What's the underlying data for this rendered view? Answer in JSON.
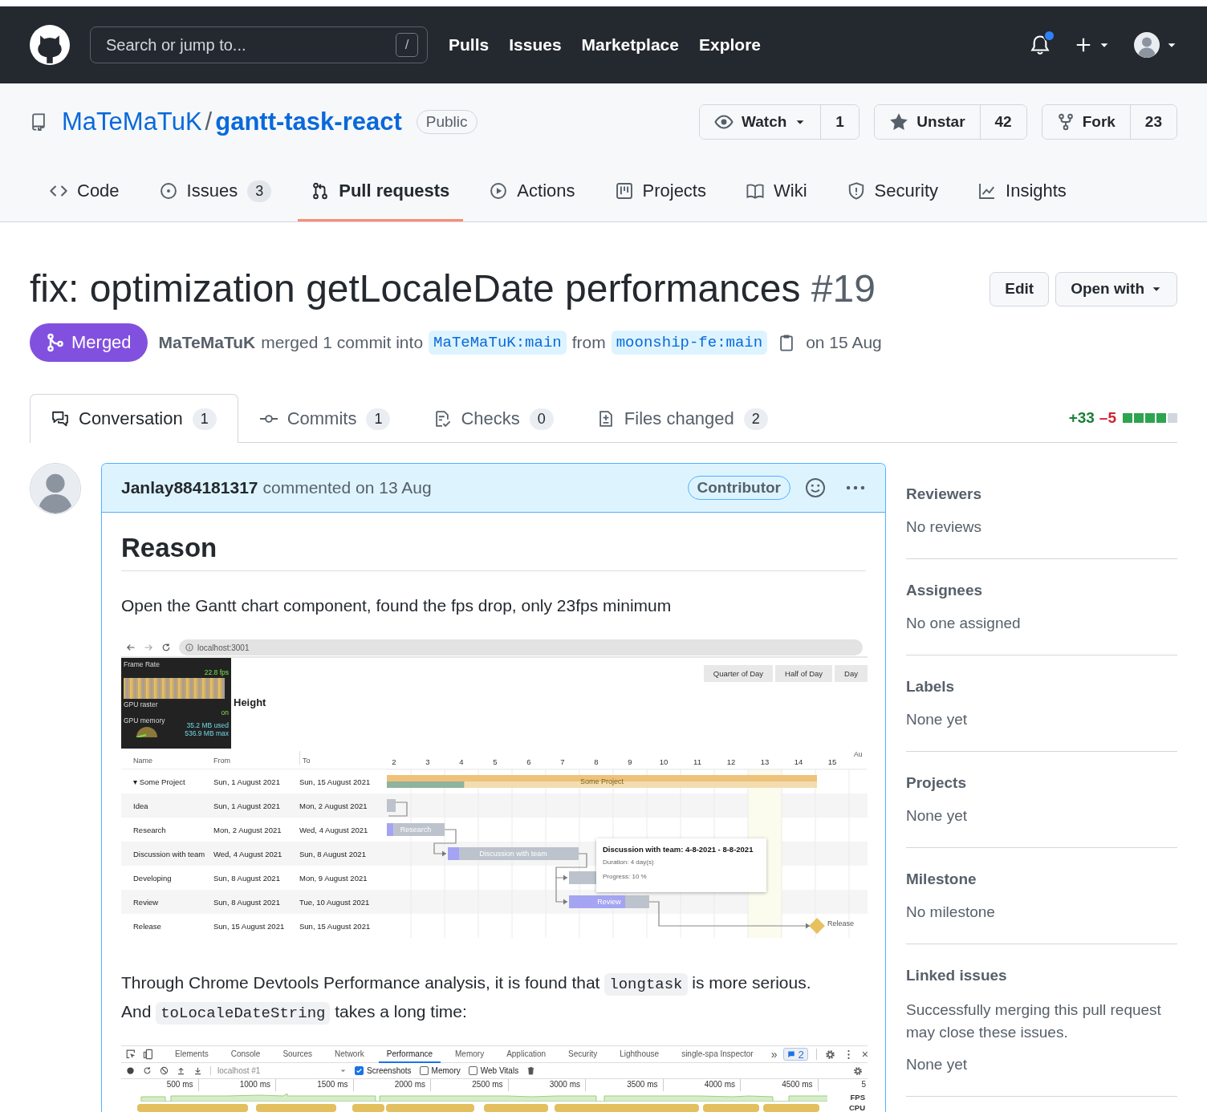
{
  "header": {
    "search_placeholder": "Search or jump to...",
    "search_key": "/",
    "nav": [
      "Pulls",
      "Issues",
      "Marketplace",
      "Explore"
    ],
    "notification_unread": true
  },
  "repo": {
    "owner": "MaTeMaTuK",
    "separator": "/",
    "name": "gantt-task-react",
    "visibility": "Public",
    "actions": [
      {
        "kind": "watch",
        "label": "Watch",
        "count": "1"
      },
      {
        "kind": "star",
        "label": "Unstar",
        "count": "42"
      },
      {
        "kind": "fork",
        "label": "Fork",
        "count": "23"
      }
    ]
  },
  "tabs": [
    {
      "label": "Code",
      "selected": false
    },
    {
      "label": "Issues",
      "count": "3",
      "selected": false
    },
    {
      "label": "Pull requests",
      "selected": true
    },
    {
      "label": "Actions",
      "selected": false
    },
    {
      "label": "Projects",
      "selected": false
    },
    {
      "label": "Wiki",
      "selected": false
    },
    {
      "label": "Security",
      "selected": false
    },
    {
      "label": "Insights",
      "selected": false
    }
  ],
  "pull_request": {
    "title": "fix: optimization getLocaleDate performances",
    "number": "#19",
    "buttons": [
      {
        "kind": "plain",
        "label": "Edit"
      },
      {
        "kind": "menu",
        "label": "Open with"
      }
    ],
    "state": "Merged",
    "author": "MaTeMaTuK",
    "summary": "merged 1 commit into",
    "base_branch": "MaTeMaTuK:main",
    "from": "from",
    "head_branch": "moonship-fe:main",
    "date": "on 15 Aug"
  },
  "pr_tabs": [
    {
      "label": "Conversation",
      "count": "1",
      "selected": true
    },
    {
      "label": "Commits",
      "count": "1",
      "selected": false
    },
    {
      "label": "Checks",
      "count": "0",
      "selected": false
    },
    {
      "label": "Files changed",
      "count": "2",
      "selected": false
    }
  ],
  "diffstat": {
    "additions": "+33",
    "deletions": "–5",
    "blocks": [
      {
        "kind": "added"
      },
      {
        "kind": "added"
      },
      {
        "kind": "added"
      },
      {
        "kind": "added"
      },
      {
        "kind": "neutral"
      }
    ]
  },
  "comment": {
    "author": "Janlay884181317",
    "action": "commented on 13 Aug",
    "role": "Contributor",
    "heading": "Reason",
    "intro": "Open the Gantt chart component, found the fps drop, only 23fps minimum",
    "gantt": {
      "url": "localhost:3001",
      "view_modes": [
        "Quarter of Day",
        "Half of Day",
        "Day"
      ],
      "heading": "Height",
      "fps_meter": {
        "title": "Frame Rate",
        "fps": "22.8 fps",
        "raster_label": "GPU raster",
        "raster_state": "on",
        "memory_label": "GPU memory",
        "memory_used": "35.2 MB used",
        "memory_max": "536.9 MB max"
      },
      "columns": [
        "Name",
        "From",
        "To"
      ],
      "month": "Au",
      "days": [
        "2",
        "3",
        "4",
        "5",
        "6",
        "7",
        "8",
        "9",
        "10",
        "11",
        "12",
        "13",
        "14",
        "15"
      ],
      "tasks": [
        {
          "kind": "project",
          "toggle": "▾",
          "name": "Some Project",
          "from": "Sun, 1 August 2021",
          "to": "Sun, 15 August 2021",
          "bar_label": "Some Project",
          "level": 0.18
        },
        {
          "kind": "task",
          "name": "Idea",
          "from": "Sun, 1 August 2021",
          "to": "Mon, 2 August 2021"
        },
        {
          "kind": "task",
          "name": "Research",
          "from": "Mon, 2 August 2021",
          "to": "Wed, 4 August 2021",
          "bar_label": "Research",
          "level": 0.12
        },
        {
          "kind": "task",
          "name": "Discussion with team",
          "from": "Wed, 4 August 2021",
          "to": "Sun, 8 August 2021",
          "bar_label": "Discussion with team",
          "level": 0.09
        },
        {
          "kind": "task",
          "name": "Developing",
          "from": "Sun, 8 August 2021",
          "to": "Mon, 9 August 2021"
        },
        {
          "kind": "task",
          "name": "Review",
          "from": "Sun, 8 August 2021",
          "to": "Tue, 10 August 2021",
          "bar_label": "Review",
          "level": 0.7
        },
        {
          "kind": "milestone",
          "name": "Release",
          "from": "Sun, 15 August 2021",
          "to": "Sun, 15 August 2021",
          "bar_label": "Release"
        }
      ],
      "tooltip": {
        "title": "Discussion with team: 4-8-2021 - 8-8-2021",
        "duration": "Duration: 4 day(s)",
        "progress": "Progress: 10 %"
      }
    },
    "analysis": [
      {
        "kind": "text",
        "text": "Through Chrome Devtools Performance analysis, it is found that "
      },
      {
        "kind": "code",
        "text": "longtask"
      },
      {
        "kind": "text",
        "text": " is more serious."
      },
      {
        "kind": "break"
      },
      {
        "kind": "text",
        "text": "And "
      },
      {
        "kind": "code",
        "text": "toLocaleDateString"
      },
      {
        "kind": "text",
        "text": " takes a long time:"
      }
    ],
    "devtools": {
      "tabs": [
        {
          "label": "Elements",
          "selected": false
        },
        {
          "label": "Console",
          "selected": false
        },
        {
          "label": "Sources",
          "selected": false
        },
        {
          "label": "Network",
          "selected": false
        },
        {
          "label": "Performance",
          "selected": true
        },
        {
          "label": "Memory",
          "selected": false
        },
        {
          "label": "Application",
          "selected": false
        },
        {
          "label": "Security",
          "selected": false
        },
        {
          "label": "Lighthouse",
          "selected": false
        },
        {
          "label": "single-spa Inspector",
          "selected": false
        }
      ],
      "more": "»",
      "issue_count": "2",
      "close": "×",
      "target": "localhost #1",
      "options": [
        {
          "label": "Screenshots",
          "checked": true
        },
        {
          "label": "Memory",
          "checked": false
        },
        {
          "label": "Web Vitals",
          "checked": false
        }
      ],
      "ticks": [
        "500 ms",
        "1000 ms",
        "1500 ms",
        "2000 ms",
        "2500 ms",
        "3000 ms",
        "3500 ms",
        "4000 ms",
        "4500 ms",
        "5"
      ],
      "tracks": [
        "FPS",
        "CPU"
      ]
    }
  },
  "sidebar": [
    {
      "title": "Reviewers",
      "value": "No reviews"
    },
    {
      "title": "Assignees",
      "value": "No one assigned"
    },
    {
      "title": "Labels",
      "value": "None yet"
    },
    {
      "title": "Projects",
      "value": "None yet"
    },
    {
      "title": "Milestone",
      "value": "No milestone"
    },
    {
      "title": "Linked issues",
      "note": "Successfully merging this pull request may close these issues.",
      "value": "None yet"
    }
  ]
}
